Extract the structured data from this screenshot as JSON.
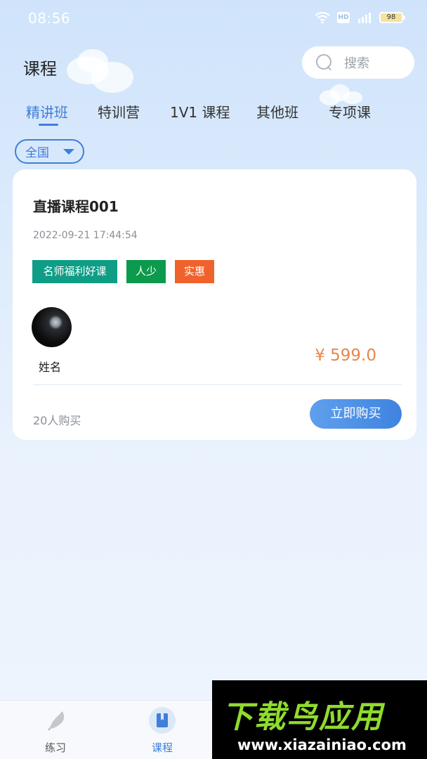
{
  "status_bar": {
    "time": "08:56",
    "hd": "HD",
    "battery": "98"
  },
  "header": {
    "title": "课程",
    "search_placeholder": "搜索"
  },
  "tabs": [
    {
      "label": "精讲班",
      "active": true
    },
    {
      "label": "特训营",
      "active": false
    },
    {
      "label": "1V1 课程",
      "active": false
    },
    {
      "label": "其他班",
      "active": false
    },
    {
      "label": "专项课",
      "active": false
    }
  ],
  "filter": {
    "region": "全国"
  },
  "course": {
    "title": "直播课程001",
    "date": "2022-09-21 17:44:54",
    "tags": [
      {
        "label": "名师福利好课",
        "color": "#0f9d86"
      },
      {
        "label": "人少",
        "color": "#0c9a4c"
      },
      {
        "label": "实惠",
        "color": "#f0622c"
      }
    ],
    "teacher_name": "姓名",
    "price": "¥ 599.0",
    "buy_count": "20人购买",
    "buy_label": "立即购买"
  },
  "bottom_nav": [
    {
      "label": "练习",
      "icon": "feather-icon",
      "active": false
    },
    {
      "label": "课程",
      "icon": "book-icon",
      "active": true
    }
  ],
  "watermark": {
    "title": "下载鸟应用",
    "url": "www.xiazainiao.com"
  },
  "colors": {
    "accent": "#3f7ed9",
    "price": "#e8854c"
  }
}
